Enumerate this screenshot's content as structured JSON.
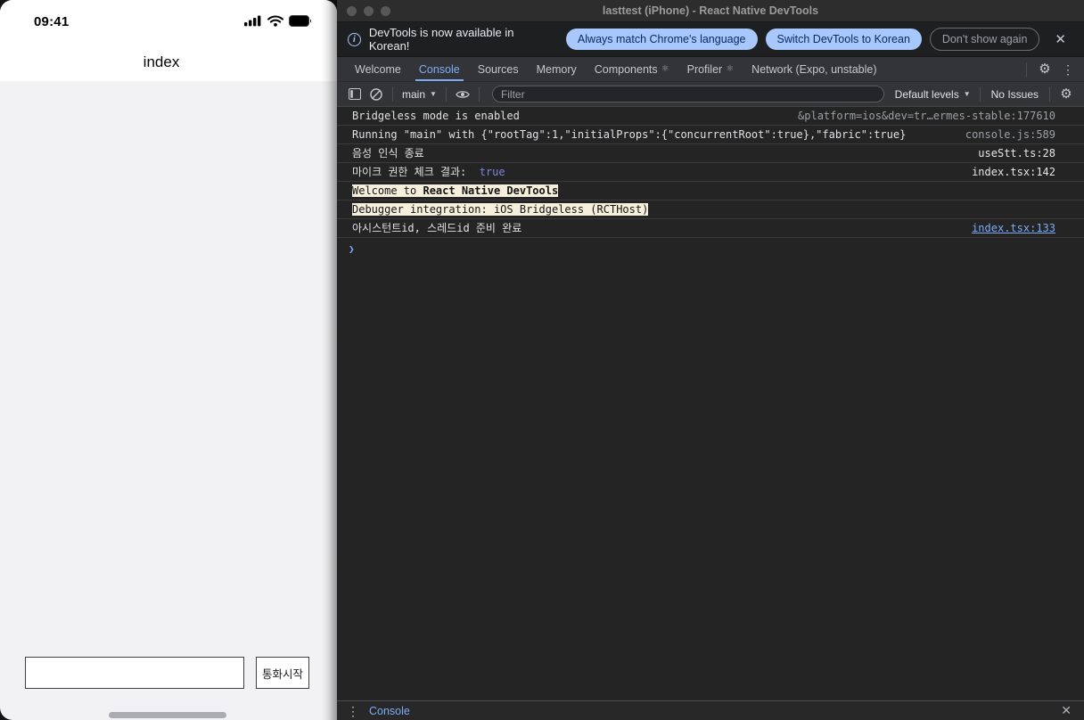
{
  "phone": {
    "status_time": "09:41",
    "nav_title": "index",
    "call_button_label": "통화시작"
  },
  "devtools": {
    "window_title": "lasttest (iPhone) - React Native DevTools",
    "infobar": {
      "message": "DevTools is now available in Korean!",
      "btn_match_language": "Always match Chrome's language",
      "btn_switch_korean": "Switch DevTools to Korean",
      "btn_dont_show": "Don't show again",
      "close_label": "✕"
    },
    "tabs": [
      {
        "label": "Welcome",
        "active": false,
        "atom": false
      },
      {
        "label": "Console",
        "active": true,
        "atom": false
      },
      {
        "label": "Sources",
        "active": false,
        "atom": false
      },
      {
        "label": "Memory",
        "active": false,
        "atom": false
      },
      {
        "label": "Components",
        "active": false,
        "atom": true
      },
      {
        "label": "Profiler",
        "active": false,
        "atom": true
      },
      {
        "label": "Network (Expo, unstable)",
        "active": false,
        "atom": false
      }
    ],
    "toolbar": {
      "context_selector": "main",
      "filter_placeholder": "Filter",
      "levels_label": "Default levels",
      "issues_label": "No Issues"
    },
    "console_rows": [
      {
        "segments": [
          {
            "t": "Bridgeless mode is enabled",
            "style": "plain"
          }
        ],
        "src": "&platform=ios&dev=tr…ermes-stable:177610",
        "src_style": "muted"
      },
      {
        "segments": [
          {
            "t": "Running \"main\" with {\"rootTag\":1,\"initialProps\":{\"concurrentRoot\":true},\"fabric\":true}",
            "style": "plain"
          }
        ],
        "src": "console.js:589",
        "src_style": "muted"
      },
      {
        "segments": [
          {
            "t": "음성 인식 종료",
            "style": "plain"
          }
        ],
        "src": "useStt.ts:28",
        "src_style": "light"
      },
      {
        "segments": [
          {
            "t": "마이크 권한 체크 결과: ",
            "style": "plain"
          },
          {
            "t": " true",
            "style": "bool"
          }
        ],
        "src": "index.tsx:142",
        "src_style": "light"
      },
      {
        "segments": [
          {
            "t": "Welcome to ",
            "style": "hl"
          },
          {
            "t": "React Native DevTools",
            "style": "hl-bold"
          }
        ],
        "src": "",
        "src_style": "none"
      },
      {
        "segments": [
          {
            "t": "Debugger integration: iOS Bridgeless (RCTHost)",
            "style": "hl"
          }
        ],
        "src": "",
        "src_style": "none"
      },
      {
        "segments": [
          {
            "t": "아시스턴트id, 스레드id 준비 완료",
            "style": "plain"
          }
        ],
        "src": "index.tsx:133",
        "src_style": "link"
      }
    ],
    "prompt_chevron": "❯",
    "drawer": {
      "label": "Console",
      "close_label": "✕"
    },
    "colors": {
      "accent_blue": "#7cacf8",
      "pill_bg": "#a8c7fa",
      "boolean_value": "#7d84dc",
      "highlight_bg": "#f5efdb",
      "console_bg": "#242424"
    }
  }
}
